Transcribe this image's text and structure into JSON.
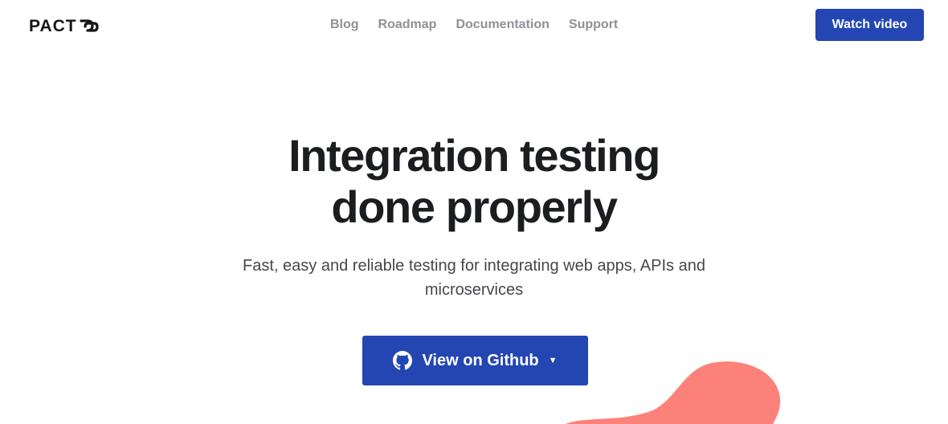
{
  "header": {
    "logo_text": "PACT",
    "logo_icon": "chain-link-icon",
    "nav": [
      {
        "label": "Blog"
      },
      {
        "label": "Roadmap"
      },
      {
        "label": "Documentation"
      },
      {
        "label": "Support"
      }
    ],
    "watch_video_label": "Watch video"
  },
  "hero": {
    "title_line1": "Integration testing",
    "title_line2": "done properly",
    "subtitle": "Fast, easy and reliable testing for integrating web apps, APIs and microservices",
    "github_button": {
      "label": "View on Github",
      "icon": "github-icon",
      "caret_icon": "caret-down-icon"
    }
  },
  "colors": {
    "accent": "#2346b3",
    "nav_text": "#8f9196",
    "blob": "#fc8279"
  }
}
